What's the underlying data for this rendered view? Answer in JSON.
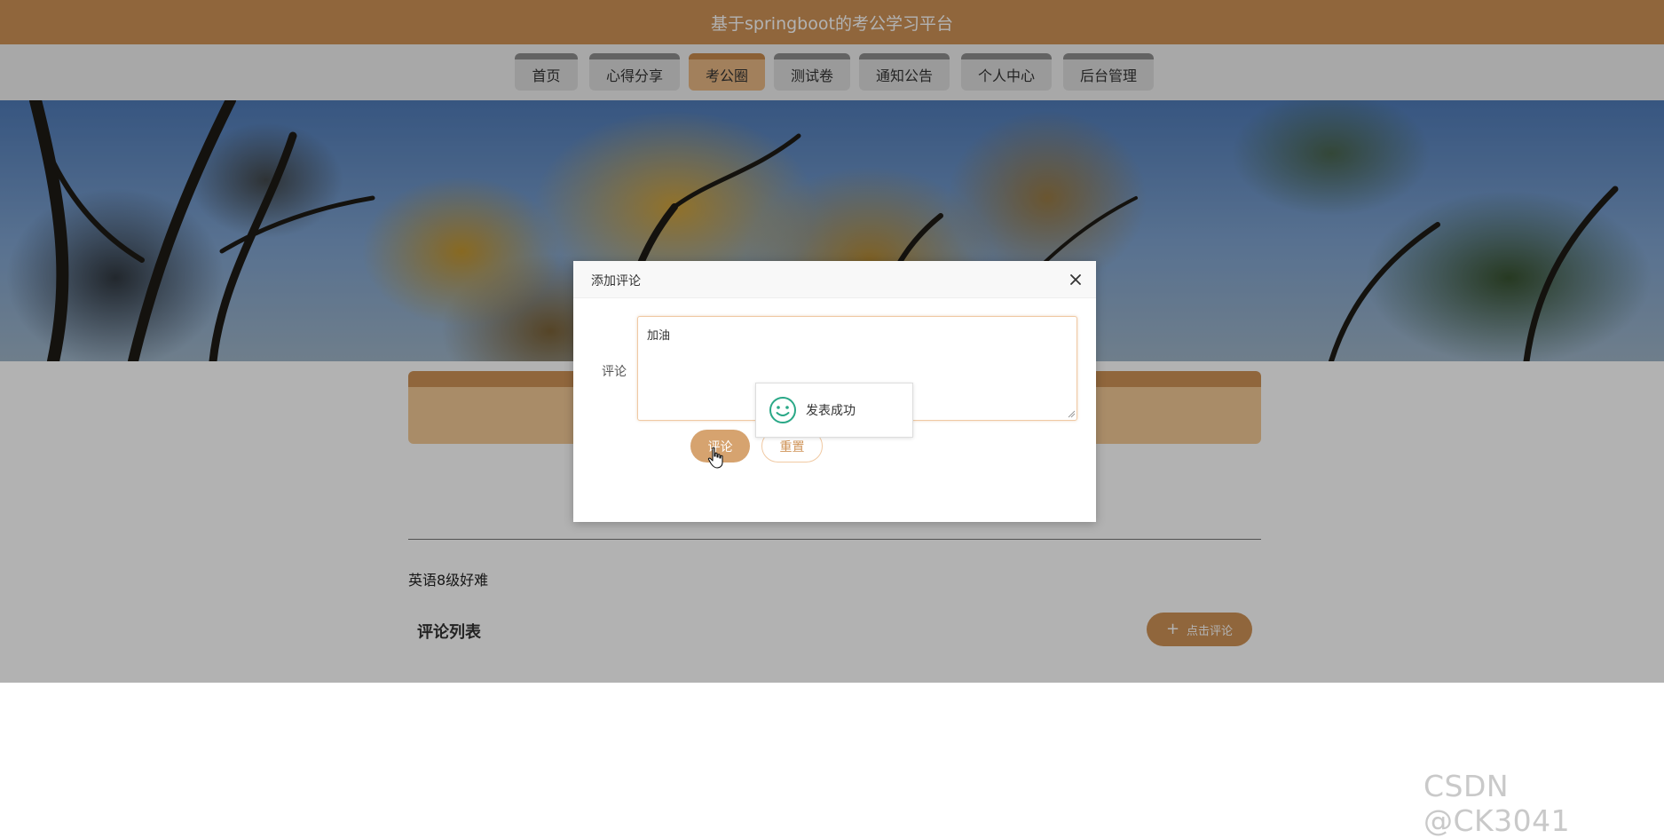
{
  "app": {
    "title": "基于springboot的考公学习平台"
  },
  "nav": {
    "items": [
      {
        "label": "首页"
      },
      {
        "label": "心得分享"
      },
      {
        "label": "考公圈"
      },
      {
        "label": "测试卷"
      },
      {
        "label": "通知公告"
      },
      {
        "label": "个人中心"
      },
      {
        "label": "后台管理"
      }
    ],
    "active_index": 2,
    "colors": {
      "accent": "#cf9357",
      "inactive": "#dddddd"
    }
  },
  "post": {
    "content": "英语8级好难",
    "comments_title": "评论列表",
    "add_comment_label": "点击评论"
  },
  "dialog": {
    "title": "添加评论",
    "field_label": "评论",
    "comment_value": "加油",
    "submit_label": "评论",
    "reset_label": "重置"
  },
  "toast": {
    "message": "发表成功",
    "icon": "smile-icon"
  },
  "watermark": {
    "text": "CSDN @CK3041"
  }
}
